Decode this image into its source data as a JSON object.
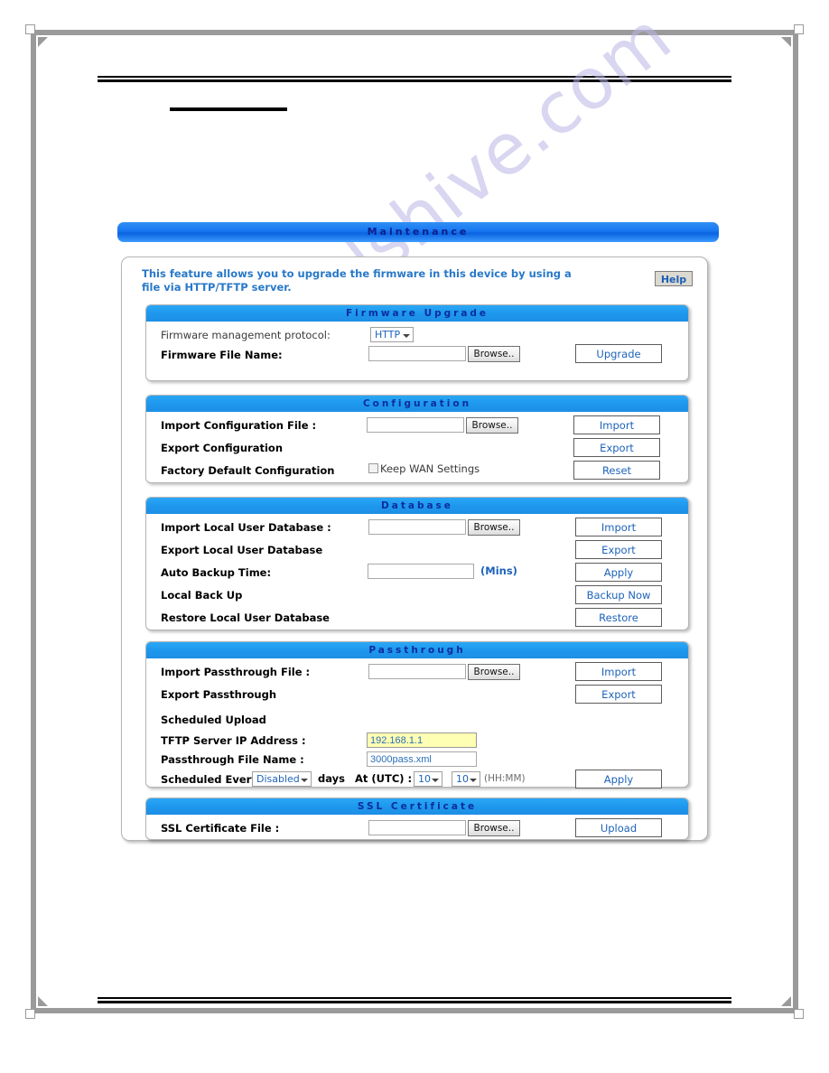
{
  "document": {
    "watermark": "manualshive.com"
  },
  "ui": {
    "title": "Maintenance",
    "intro": "This feature allows you to upgrade the firmware in this device by using a file via HTTP/TFTP server.",
    "help_label": "Help",
    "accent_header": "#1d98ee",
    "accent_titlebar": "#1776f0",
    "link_color": "#1d63ba",
    "intro_color": "#2878c8",
    "highlight_field_color": "#ffffb3",
    "sections": [
      {
        "id": "firmware-upgrade",
        "title": "Firmware Upgrade",
        "rows": [
          {
            "label": "Firmware management protocol:",
            "bold": false,
            "control": "select",
            "value": "HTTP"
          },
          {
            "label": "Firmware File Name:",
            "bold": true,
            "control": "file",
            "value": "",
            "browse_label": "Browse..",
            "action_label": "Upgrade"
          }
        ]
      },
      {
        "id": "configuration",
        "title": "Configuration",
        "rows": [
          {
            "label": "Import Configuration File :",
            "bold": true,
            "control": "file",
            "value": "",
            "browse_label": "Browse..",
            "action_label": "Import"
          },
          {
            "label": "Export Configuration",
            "bold": true,
            "control": "none",
            "action_label": "Export"
          },
          {
            "label": "Factory Default Configuration",
            "bold": true,
            "control": "checkbox",
            "checkbox_label": "Keep WAN Settings",
            "checked": false,
            "action_label": "Reset"
          }
        ]
      },
      {
        "id": "database",
        "title": "Database",
        "rows": [
          {
            "label": "Import Local User Database :",
            "bold": true,
            "control": "file",
            "value": "",
            "browse_label": "Browse..",
            "action_label": "Import"
          },
          {
            "label": "Export Local User Database",
            "bold": true,
            "control": "none",
            "action_label": "Export"
          },
          {
            "label": "Auto Backup Time:",
            "bold": true,
            "control": "text",
            "value": "",
            "suffix": "(Mins)",
            "action_label": "Apply"
          },
          {
            "label": "Local Back Up",
            "bold": true,
            "control": "none",
            "action_label": "Backup Now"
          },
          {
            "label": "Restore Local User Database",
            "bold": true,
            "control": "none",
            "action_label": "Restore"
          }
        ]
      },
      {
        "id": "passthrough",
        "title": "Passthrough",
        "rows": [
          {
            "label": "Import Passthrough File :",
            "bold": true,
            "control": "file",
            "value": "",
            "browse_label": "Browse..",
            "action_label": "Import"
          },
          {
            "label": "Export Passthrough",
            "bold": true,
            "control": "none",
            "action_label": "Export"
          }
        ],
        "subheading": "Scheduled Upload",
        "scheduled": {
          "tftp_label": "TFTP Server IP Address :",
          "tftp_value": "192.168.1.1",
          "file_label": "Passthrough File Name :",
          "file_value": "3000pass.xml",
          "every_label": "Scheduled Every:",
          "every_value": "Disabled",
          "days_label": "days",
          "at_label": "At (UTC) :",
          "hour_value": "10",
          "minute_value": "10",
          "hhmm_label": "(HH:MM)",
          "apply_label": "Apply"
        }
      },
      {
        "id": "ssl-certificate",
        "title": "SSL Certificate",
        "rows": [
          {
            "label": "SSL Certificate File :",
            "bold": true,
            "control": "file",
            "value": "",
            "browse_label": "Browse..",
            "action_label": "Upload"
          }
        ]
      }
    ]
  }
}
